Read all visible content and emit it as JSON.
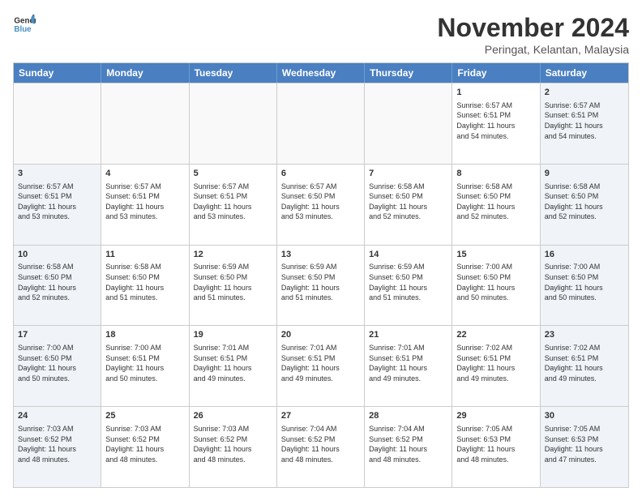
{
  "logo": {
    "line1": "General",
    "line2": "Blue"
  },
  "title": "November 2024",
  "subtitle": "Peringat, Kelantan, Malaysia",
  "days": [
    "Sunday",
    "Monday",
    "Tuesday",
    "Wednesday",
    "Thursday",
    "Friday",
    "Saturday"
  ],
  "weeks": [
    [
      {
        "day": "",
        "info": ""
      },
      {
        "day": "",
        "info": ""
      },
      {
        "day": "",
        "info": ""
      },
      {
        "day": "",
        "info": ""
      },
      {
        "day": "",
        "info": ""
      },
      {
        "day": "1",
        "info": "Sunrise: 6:57 AM\nSunset: 6:51 PM\nDaylight: 11 hours\nand 54 minutes."
      },
      {
        "day": "2",
        "info": "Sunrise: 6:57 AM\nSunset: 6:51 PM\nDaylight: 11 hours\nand 54 minutes."
      }
    ],
    [
      {
        "day": "3",
        "info": "Sunrise: 6:57 AM\nSunset: 6:51 PM\nDaylight: 11 hours\nand 53 minutes."
      },
      {
        "day": "4",
        "info": "Sunrise: 6:57 AM\nSunset: 6:51 PM\nDaylight: 11 hours\nand 53 minutes."
      },
      {
        "day": "5",
        "info": "Sunrise: 6:57 AM\nSunset: 6:51 PM\nDaylight: 11 hours\nand 53 minutes."
      },
      {
        "day": "6",
        "info": "Sunrise: 6:57 AM\nSunset: 6:50 PM\nDaylight: 11 hours\nand 53 minutes."
      },
      {
        "day": "7",
        "info": "Sunrise: 6:58 AM\nSunset: 6:50 PM\nDaylight: 11 hours\nand 52 minutes."
      },
      {
        "day": "8",
        "info": "Sunrise: 6:58 AM\nSunset: 6:50 PM\nDaylight: 11 hours\nand 52 minutes."
      },
      {
        "day": "9",
        "info": "Sunrise: 6:58 AM\nSunset: 6:50 PM\nDaylight: 11 hours\nand 52 minutes."
      }
    ],
    [
      {
        "day": "10",
        "info": "Sunrise: 6:58 AM\nSunset: 6:50 PM\nDaylight: 11 hours\nand 52 minutes."
      },
      {
        "day": "11",
        "info": "Sunrise: 6:58 AM\nSunset: 6:50 PM\nDaylight: 11 hours\nand 51 minutes."
      },
      {
        "day": "12",
        "info": "Sunrise: 6:59 AM\nSunset: 6:50 PM\nDaylight: 11 hours\nand 51 minutes."
      },
      {
        "day": "13",
        "info": "Sunrise: 6:59 AM\nSunset: 6:50 PM\nDaylight: 11 hours\nand 51 minutes."
      },
      {
        "day": "14",
        "info": "Sunrise: 6:59 AM\nSunset: 6:50 PM\nDaylight: 11 hours\nand 51 minutes."
      },
      {
        "day": "15",
        "info": "Sunrise: 7:00 AM\nSunset: 6:50 PM\nDaylight: 11 hours\nand 50 minutes."
      },
      {
        "day": "16",
        "info": "Sunrise: 7:00 AM\nSunset: 6:50 PM\nDaylight: 11 hours\nand 50 minutes."
      }
    ],
    [
      {
        "day": "17",
        "info": "Sunrise: 7:00 AM\nSunset: 6:50 PM\nDaylight: 11 hours\nand 50 minutes."
      },
      {
        "day": "18",
        "info": "Sunrise: 7:00 AM\nSunset: 6:51 PM\nDaylight: 11 hours\nand 50 minutes."
      },
      {
        "day": "19",
        "info": "Sunrise: 7:01 AM\nSunset: 6:51 PM\nDaylight: 11 hours\nand 49 minutes."
      },
      {
        "day": "20",
        "info": "Sunrise: 7:01 AM\nSunset: 6:51 PM\nDaylight: 11 hours\nand 49 minutes."
      },
      {
        "day": "21",
        "info": "Sunrise: 7:01 AM\nSunset: 6:51 PM\nDaylight: 11 hours\nand 49 minutes."
      },
      {
        "day": "22",
        "info": "Sunrise: 7:02 AM\nSunset: 6:51 PM\nDaylight: 11 hours\nand 49 minutes."
      },
      {
        "day": "23",
        "info": "Sunrise: 7:02 AM\nSunset: 6:51 PM\nDaylight: 11 hours\nand 49 minutes."
      }
    ],
    [
      {
        "day": "24",
        "info": "Sunrise: 7:03 AM\nSunset: 6:52 PM\nDaylight: 11 hours\nand 48 minutes."
      },
      {
        "day": "25",
        "info": "Sunrise: 7:03 AM\nSunset: 6:52 PM\nDaylight: 11 hours\nand 48 minutes."
      },
      {
        "day": "26",
        "info": "Sunrise: 7:03 AM\nSunset: 6:52 PM\nDaylight: 11 hours\nand 48 minutes."
      },
      {
        "day": "27",
        "info": "Sunrise: 7:04 AM\nSunset: 6:52 PM\nDaylight: 11 hours\nand 48 minutes."
      },
      {
        "day": "28",
        "info": "Sunrise: 7:04 AM\nSunset: 6:52 PM\nDaylight: 11 hours\nand 48 minutes."
      },
      {
        "day": "29",
        "info": "Sunrise: 7:05 AM\nSunset: 6:53 PM\nDaylight: 11 hours\nand 48 minutes."
      },
      {
        "day": "30",
        "info": "Sunrise: 7:05 AM\nSunset: 6:53 PM\nDaylight: 11 hours\nand 47 minutes."
      }
    ]
  ]
}
